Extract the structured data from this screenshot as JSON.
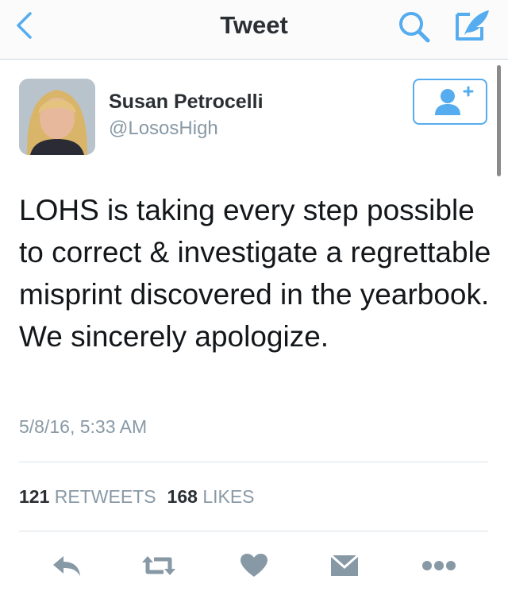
{
  "header": {
    "title": "Tweet",
    "back_icon": "chevron-left-icon",
    "search_icon": "search-icon",
    "compose_icon": "compose-icon",
    "accent_color": "#55acee"
  },
  "tweet": {
    "author_name": "Susan Petrocelli",
    "author_handle": "@LososHigh",
    "text": "LOHS is taking every step possible to correct & investigate a regrettable misprint discovered in the yearbook. We sincerely apologize.",
    "timestamp": "5/8/16, 5:33 AM",
    "follow_icon": "add-user-icon"
  },
  "stats": {
    "retweets_count": "121",
    "retweets_label": "RETWEETS",
    "likes_count": "168",
    "likes_label": "LIKES"
  },
  "actions": {
    "reply_icon": "reply-icon",
    "retweet_icon": "retweet-icon",
    "like_icon": "heart-icon",
    "message_icon": "envelope-icon",
    "more_icon": "more-icon",
    "icon_color": "#8899a6"
  }
}
